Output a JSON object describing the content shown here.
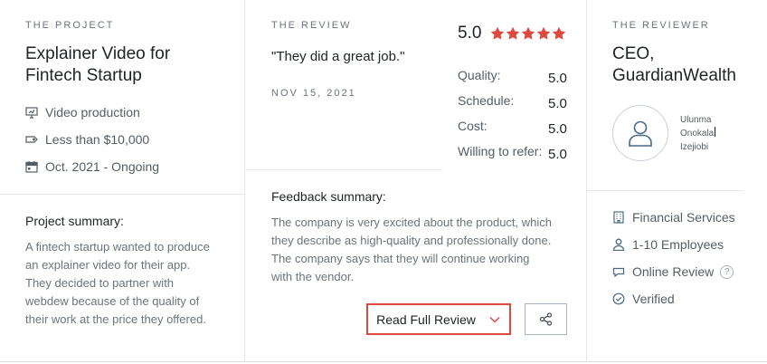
{
  "project": {
    "eyebrow": "THE PROJECT",
    "title_line1": "Explainer Video for",
    "title_line2": "Fintech Startup",
    "service": "Video production",
    "budget": "Less than $10,000",
    "timeline": "Oct. 2021 - Ongoing",
    "summary_heading": "Project summary:",
    "summary_lines": [
      "A fintech startup wanted to produce",
      "an explainer video for their app.",
      "They decided to partner with",
      "webdew because of the quality of",
      "their work at the price they offered."
    ]
  },
  "review": {
    "eyebrow": "THE REVIEW",
    "quote": "\"They did a great job.\"",
    "date": "NOV 15, 2021",
    "overall": "5.0",
    "star_count": 5,
    "star_color": "#e0493f",
    "ratings": [
      {
        "label": "Quality:",
        "value": "5.0"
      },
      {
        "label": "Schedule:",
        "value": "5.0"
      },
      {
        "label": "Cost:",
        "value": "5.0"
      },
      {
        "label": "Willing to refer:",
        "value": "5.0"
      }
    ],
    "feedback_heading": "Feedback summary:",
    "feedback_lines": [
      "The company is very excited about the product, which",
      "they describe as high-quality and professionally done.",
      "The company says that they will continue working",
      "with the vendor."
    ],
    "read_full_label": "Read Full Review"
  },
  "reviewer": {
    "eyebrow": "THE REVIEWER",
    "title_line1": "CEO,",
    "title_line2": "GuardianWealth",
    "name_lines": [
      "Ulunma",
      "Onokala",
      "Izejiobi"
    ],
    "industry": "Financial Services",
    "size": "1-10 Employees",
    "review_type": "Online Review",
    "help_glyph": "?",
    "status": "Verified"
  }
}
